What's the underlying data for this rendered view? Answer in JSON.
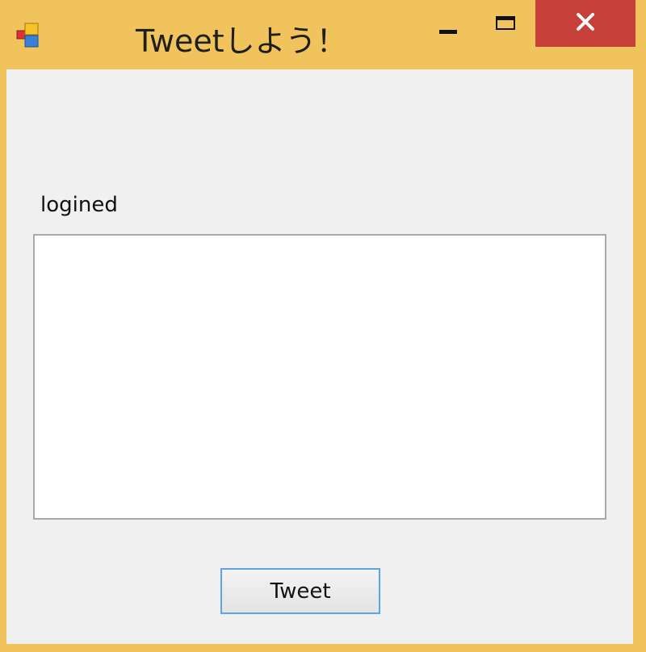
{
  "window": {
    "title": "Tweetしよう！"
  },
  "titlebar": {
    "app_icon": "app-form-icon",
    "minimize_icon": "minimize-icon",
    "maximize_icon": "maximize-icon",
    "close_icon": "close-icon",
    "close_color": "#c8403a",
    "frame_color": "#f1c35c"
  },
  "main": {
    "status_label": "logined",
    "tweet_text": "",
    "tweet_button_label": "Tweet"
  }
}
